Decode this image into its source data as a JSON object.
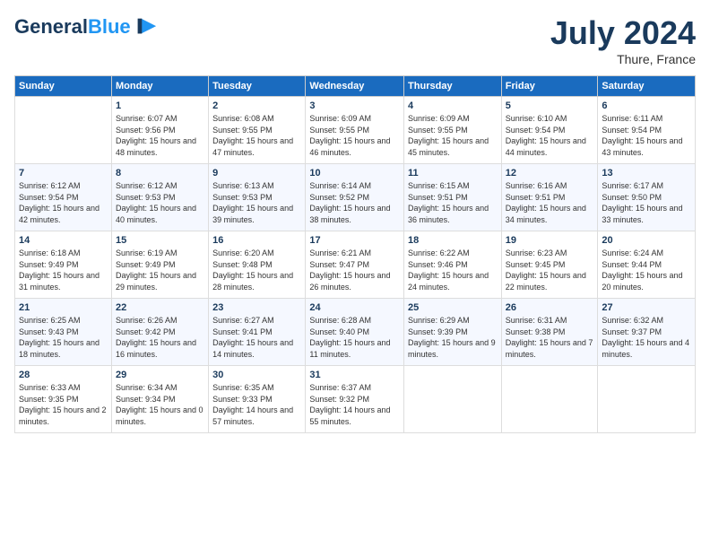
{
  "logo": {
    "line1": "General",
    "line2": "Blue"
  },
  "title": "July 2024",
  "location": "Thure, France",
  "headers": [
    "Sunday",
    "Monday",
    "Tuesday",
    "Wednesday",
    "Thursday",
    "Friday",
    "Saturday"
  ],
  "weeks": [
    [
      {
        "day": "",
        "sunrise": "",
        "sunset": "",
        "daylight": ""
      },
      {
        "day": "1",
        "sunrise": "Sunrise: 6:07 AM",
        "sunset": "Sunset: 9:56 PM",
        "daylight": "Daylight: 15 hours and 48 minutes."
      },
      {
        "day": "2",
        "sunrise": "Sunrise: 6:08 AM",
        "sunset": "Sunset: 9:55 PM",
        "daylight": "Daylight: 15 hours and 47 minutes."
      },
      {
        "day": "3",
        "sunrise": "Sunrise: 6:09 AM",
        "sunset": "Sunset: 9:55 PM",
        "daylight": "Daylight: 15 hours and 46 minutes."
      },
      {
        "day": "4",
        "sunrise": "Sunrise: 6:09 AM",
        "sunset": "Sunset: 9:55 PM",
        "daylight": "Daylight: 15 hours and 45 minutes."
      },
      {
        "day": "5",
        "sunrise": "Sunrise: 6:10 AM",
        "sunset": "Sunset: 9:54 PM",
        "daylight": "Daylight: 15 hours and 44 minutes."
      },
      {
        "day": "6",
        "sunrise": "Sunrise: 6:11 AM",
        "sunset": "Sunset: 9:54 PM",
        "daylight": "Daylight: 15 hours and 43 minutes."
      }
    ],
    [
      {
        "day": "7",
        "sunrise": "Sunrise: 6:12 AM",
        "sunset": "Sunset: 9:54 PM",
        "daylight": "Daylight: 15 hours and 42 minutes."
      },
      {
        "day": "8",
        "sunrise": "Sunrise: 6:12 AM",
        "sunset": "Sunset: 9:53 PM",
        "daylight": "Daylight: 15 hours and 40 minutes."
      },
      {
        "day": "9",
        "sunrise": "Sunrise: 6:13 AM",
        "sunset": "Sunset: 9:53 PM",
        "daylight": "Daylight: 15 hours and 39 minutes."
      },
      {
        "day": "10",
        "sunrise": "Sunrise: 6:14 AM",
        "sunset": "Sunset: 9:52 PM",
        "daylight": "Daylight: 15 hours and 38 minutes."
      },
      {
        "day": "11",
        "sunrise": "Sunrise: 6:15 AM",
        "sunset": "Sunset: 9:51 PM",
        "daylight": "Daylight: 15 hours and 36 minutes."
      },
      {
        "day": "12",
        "sunrise": "Sunrise: 6:16 AM",
        "sunset": "Sunset: 9:51 PM",
        "daylight": "Daylight: 15 hours and 34 minutes."
      },
      {
        "day": "13",
        "sunrise": "Sunrise: 6:17 AM",
        "sunset": "Sunset: 9:50 PM",
        "daylight": "Daylight: 15 hours and 33 minutes."
      }
    ],
    [
      {
        "day": "14",
        "sunrise": "Sunrise: 6:18 AM",
        "sunset": "Sunset: 9:49 PM",
        "daylight": "Daylight: 15 hours and 31 minutes."
      },
      {
        "day": "15",
        "sunrise": "Sunrise: 6:19 AM",
        "sunset": "Sunset: 9:49 PM",
        "daylight": "Daylight: 15 hours and 29 minutes."
      },
      {
        "day": "16",
        "sunrise": "Sunrise: 6:20 AM",
        "sunset": "Sunset: 9:48 PM",
        "daylight": "Daylight: 15 hours and 28 minutes."
      },
      {
        "day": "17",
        "sunrise": "Sunrise: 6:21 AM",
        "sunset": "Sunset: 9:47 PM",
        "daylight": "Daylight: 15 hours and 26 minutes."
      },
      {
        "day": "18",
        "sunrise": "Sunrise: 6:22 AM",
        "sunset": "Sunset: 9:46 PM",
        "daylight": "Daylight: 15 hours and 24 minutes."
      },
      {
        "day": "19",
        "sunrise": "Sunrise: 6:23 AM",
        "sunset": "Sunset: 9:45 PM",
        "daylight": "Daylight: 15 hours and 22 minutes."
      },
      {
        "day": "20",
        "sunrise": "Sunrise: 6:24 AM",
        "sunset": "Sunset: 9:44 PM",
        "daylight": "Daylight: 15 hours and 20 minutes."
      }
    ],
    [
      {
        "day": "21",
        "sunrise": "Sunrise: 6:25 AM",
        "sunset": "Sunset: 9:43 PM",
        "daylight": "Daylight: 15 hours and 18 minutes."
      },
      {
        "day": "22",
        "sunrise": "Sunrise: 6:26 AM",
        "sunset": "Sunset: 9:42 PM",
        "daylight": "Daylight: 15 hours and 16 minutes."
      },
      {
        "day": "23",
        "sunrise": "Sunrise: 6:27 AM",
        "sunset": "Sunset: 9:41 PM",
        "daylight": "Daylight: 15 hours and 14 minutes."
      },
      {
        "day": "24",
        "sunrise": "Sunrise: 6:28 AM",
        "sunset": "Sunset: 9:40 PM",
        "daylight": "Daylight: 15 hours and 11 minutes."
      },
      {
        "day": "25",
        "sunrise": "Sunrise: 6:29 AM",
        "sunset": "Sunset: 9:39 PM",
        "daylight": "Daylight: 15 hours and 9 minutes."
      },
      {
        "day": "26",
        "sunrise": "Sunrise: 6:31 AM",
        "sunset": "Sunset: 9:38 PM",
        "daylight": "Daylight: 15 hours and 7 minutes."
      },
      {
        "day": "27",
        "sunrise": "Sunrise: 6:32 AM",
        "sunset": "Sunset: 9:37 PM",
        "daylight": "Daylight: 15 hours and 4 minutes."
      }
    ],
    [
      {
        "day": "28",
        "sunrise": "Sunrise: 6:33 AM",
        "sunset": "Sunset: 9:35 PM",
        "daylight": "Daylight: 15 hours and 2 minutes."
      },
      {
        "day": "29",
        "sunrise": "Sunrise: 6:34 AM",
        "sunset": "Sunset: 9:34 PM",
        "daylight": "Daylight: 15 hours and 0 minutes."
      },
      {
        "day": "30",
        "sunrise": "Sunrise: 6:35 AM",
        "sunset": "Sunset: 9:33 PM",
        "daylight": "Daylight: 14 hours and 57 minutes."
      },
      {
        "day": "31",
        "sunrise": "Sunrise: 6:37 AM",
        "sunset": "Sunset: 9:32 PM",
        "daylight": "Daylight: 14 hours and 55 minutes."
      },
      {
        "day": "",
        "sunrise": "",
        "sunset": "",
        "daylight": ""
      },
      {
        "day": "",
        "sunrise": "",
        "sunset": "",
        "daylight": ""
      },
      {
        "day": "",
        "sunrise": "",
        "sunset": "",
        "daylight": ""
      }
    ]
  ]
}
